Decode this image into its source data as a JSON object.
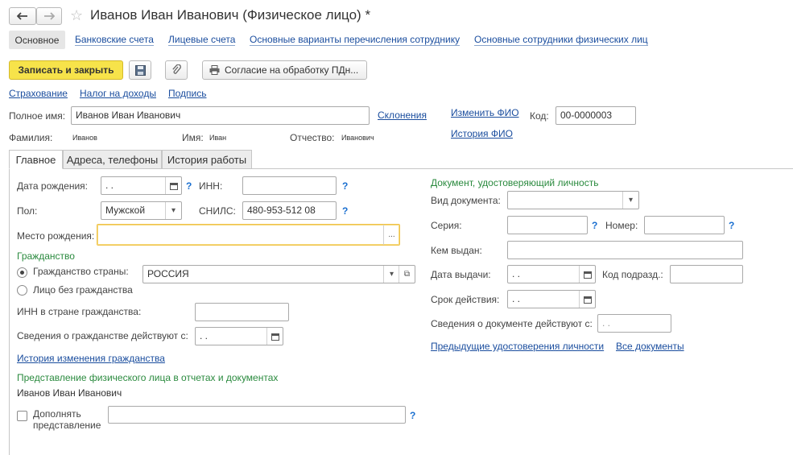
{
  "window": {
    "title": "Иванов Иван Иванович (Физическое лицо) *"
  },
  "nav": {
    "back_icon": "arrow-left-icon",
    "forward_icon": "arrow-right-icon",
    "favorite_icon": "star-icon"
  },
  "section_tabs": [
    {
      "label": "Основное",
      "active": true
    },
    {
      "label": "Банковские счета"
    },
    {
      "label": "Лицевые счета"
    },
    {
      "label": "Основные варианты перечисления сотруднику"
    },
    {
      "label": "Основные сотрудники физических лиц"
    }
  ],
  "toolbar": {
    "save_close": "Записать и закрыть",
    "save_icon": "floppy-disk-icon",
    "attach_icon": "paperclip-icon",
    "print_icon": "printer-icon",
    "consent": "Согласие на обработку ПДн..."
  },
  "links_row": {
    "insurance": "Страхование",
    "income_tax": "Налог на доходы",
    "signature": "Подпись"
  },
  "header_fields": {
    "full_name_label": "Полное имя:",
    "full_name_value": "Иванов Иван Иванович",
    "declensions": "Склонения",
    "change_fio": "Изменить ФИО",
    "history_fio": "История ФИО",
    "code_label": "Код:",
    "code_value": "00-0000003",
    "surname_label": "Фамилия:",
    "surname_value": "Иванов",
    "name_label": "Имя:",
    "name_value": "Иван",
    "patronymic_label": "Отчество:",
    "patronymic_value": "Иванович"
  },
  "tabs": [
    {
      "label": "Главное",
      "active": true
    },
    {
      "label": "Адреса, телефоны"
    },
    {
      "label": "История работы"
    }
  ],
  "main": {
    "birth_date_label": "Дата рождения:",
    "birth_date_value": " .  .",
    "inn_label": "ИНН:",
    "gender_label": "Пол:",
    "gender_value": "Мужской",
    "snils_label": "СНИЛС:",
    "snils_value": "480-953-512 08",
    "birthplace_label": "Место рождения:",
    "birthplace_button": "...",
    "help": "?",
    "citizenship_heading": "Гражданство",
    "citizenship_country_label": "Гражданство страны:",
    "citizenship_country_value": "РОССИЯ",
    "stateless_label": "Лицо без гражданства",
    "inn_citizenship_label": "ИНН в стране гражданства:",
    "citizenship_info_label": "Сведения о гражданстве действуют с:",
    "citizenship_info_value": " .  .",
    "citizenship_history": "История изменения гражданства",
    "representation_heading": "Представление физического лица в отчетах и документах",
    "representation_value": "Иванов Иван Иванович",
    "supplement_label_1": "Дополнять",
    "supplement_label_2": "представление"
  },
  "document": {
    "heading": "Документ, удостоверяющий личность",
    "type_label": "Вид документа:",
    "series_label": "Серия:",
    "number_label": "Номер:",
    "issued_by_label": "Кем выдан:",
    "issue_date_label": "Дата выдачи:",
    "issue_date_value": " .  .",
    "subdivision_code_label": "Код подразд.:",
    "validity_label": "Срок действия:",
    "validity_value": " .  .",
    "info_label": "Сведения о документе действуют с:",
    "info_value": " .  .",
    "previous_docs": "Предыдущие удостоверения личности",
    "all_docs": "Все документы"
  },
  "colors": {
    "accent_yellow": "#f7e34a",
    "link": "#1a4d9e",
    "heading_green": "#2a8a3e",
    "focus": "#f0c34a"
  }
}
